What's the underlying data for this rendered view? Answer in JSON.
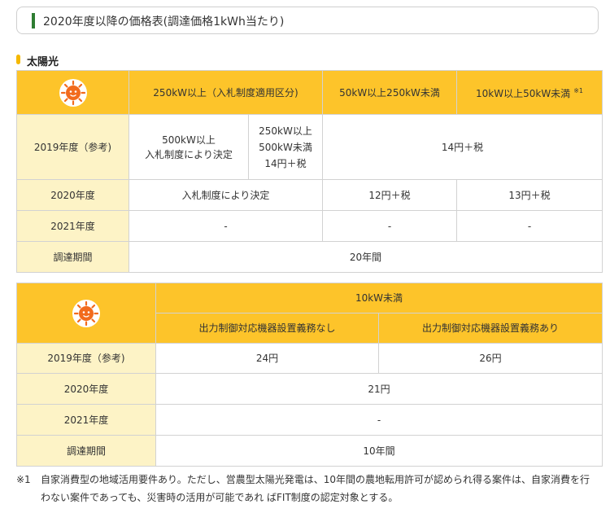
{
  "page_title": "2020年度以降の価格表(調達価格1kWh当たり)",
  "section": {
    "label": "太陽光",
    "icon": "sun-mascot-icon"
  },
  "table1": {
    "headers": {
      "col1": "250kW以上（入札制度適用区分)",
      "col2": "50kW以上250kW未満",
      "col3": "10kW以上50kW未満",
      "col3_ref": "※1"
    },
    "rows": {
      "ref2019": {
        "label": "2019年度（参考)",
        "a_line1": "500kW以上",
        "a_line2": "入札制度により決定",
        "b_line1": "250kW以上",
        "b_line2": "500kW未満",
        "b_line3": "14円＋税",
        "c": "14円＋税"
      },
      "y2020": {
        "label": "2020年度",
        "a": "入札制度により決定",
        "b": "12円＋税",
        "c": "13円＋税"
      },
      "y2021": {
        "label": "2021年度",
        "a": "-",
        "b": "-",
        "c": "-"
      },
      "period": {
        "label": "調達期間",
        "value": "20年間"
      }
    }
  },
  "table2": {
    "headers": {
      "top": "10kW未満",
      "sub1": "出力制御対応機器設置義務なし",
      "sub2": "出力制御対応機器設置義務あり"
    },
    "rows": {
      "ref2019": {
        "label": "2019年度（参考)",
        "a": "24円",
        "b": "26円"
      },
      "y2020": {
        "label": "2020年度",
        "value": "21円"
      },
      "y2021": {
        "label": "2021年度",
        "value": "-"
      },
      "period": {
        "label": "調達期間",
        "value": "10年間"
      }
    }
  },
  "footnote": {
    "mark": "※1",
    "text": "自家消費型の地域活用要件あり。ただし、営農型太陽光発電は、10年間の農地転用許可が認められ得る案件は、自家消費を行わない案件であっても、災害時の活用が可能であれ ばFIT制度の認定対象とする。"
  },
  "colors": {
    "header_yellow": "#fdc42a",
    "row_header_cream": "#fdf3c6",
    "accent_green": "#2e7d32",
    "sun_orange": "#f26b1d"
  }
}
